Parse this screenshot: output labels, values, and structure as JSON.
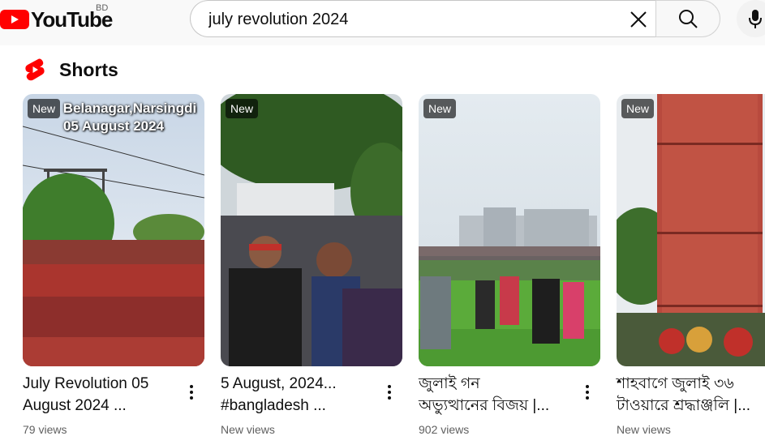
{
  "header": {
    "logo_text": "YouTube",
    "country_code": "BD",
    "search_value": "july revolution 2024",
    "colors": {
      "brand_red": "#ff0000",
      "text": "#0f0f0f"
    }
  },
  "shorts": {
    "title": "Shorts",
    "icon": "shorts-icon",
    "cards": [
      {
        "badge": "New",
        "overlay_line1": "Belanagar,Narsingdi",
        "overlay_line2": "05 August 2024",
        "title": "July Revolution 05\nAugust 2024 ...",
        "views": "79 views"
      },
      {
        "badge": "New",
        "title": "5 August, 2024...\n#bangladesh ...",
        "views": "New views"
      },
      {
        "badge": "New",
        "title": "জুলাই গন\nঅভ্যুত্থানের বিজয় |...",
        "views": "902 views"
      },
      {
        "badge": "New",
        "title": "শাহবাগে জুলাই ৩৬\nটাওয়ারে শ্রদ্ধাঞ্জলি |...",
        "views": "New views"
      }
    ]
  }
}
